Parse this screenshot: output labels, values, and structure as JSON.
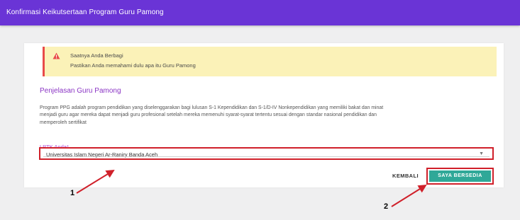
{
  "header": {
    "title": "Konfirmasi Keikutsertaan Program Guru Pamong"
  },
  "alert": {
    "icon": "warning-icon",
    "title": "Saatnya Anda Berbagi",
    "text": "Pastikan Anda memahami dulu apa itu Guru Pamong"
  },
  "section": {
    "title": "Penjelasan Guru Pamong",
    "lines": [
      "Program PPG adalah program pendidikan yang diselenggarakan bagi lulusan S-1 Kependidikan dan S-1/D-IV Nonkependidikan yang memiliki bakat dan minat",
      "menjadi guru agar mereka dapat menjadi guru profesional setelah mereka memenuhi syarat-syarat tertentu sesuai dengan standar nasional pendidikan dan",
      "memperoleh sertifikat"
    ]
  },
  "form": {
    "lptk_label": "LPTK Anda*",
    "lptk_value": "Universitas Islam Negeri Ar-Raniry Banda Aceh",
    "arrow_icon": "dropdown-arrow-icon"
  },
  "actions": {
    "back_label": "KEMBALI",
    "agree_label": "SAYA BERSEDIA"
  },
  "annotations": {
    "marker_1": "1",
    "marker_2": "2",
    "color": "#d0202a"
  }
}
